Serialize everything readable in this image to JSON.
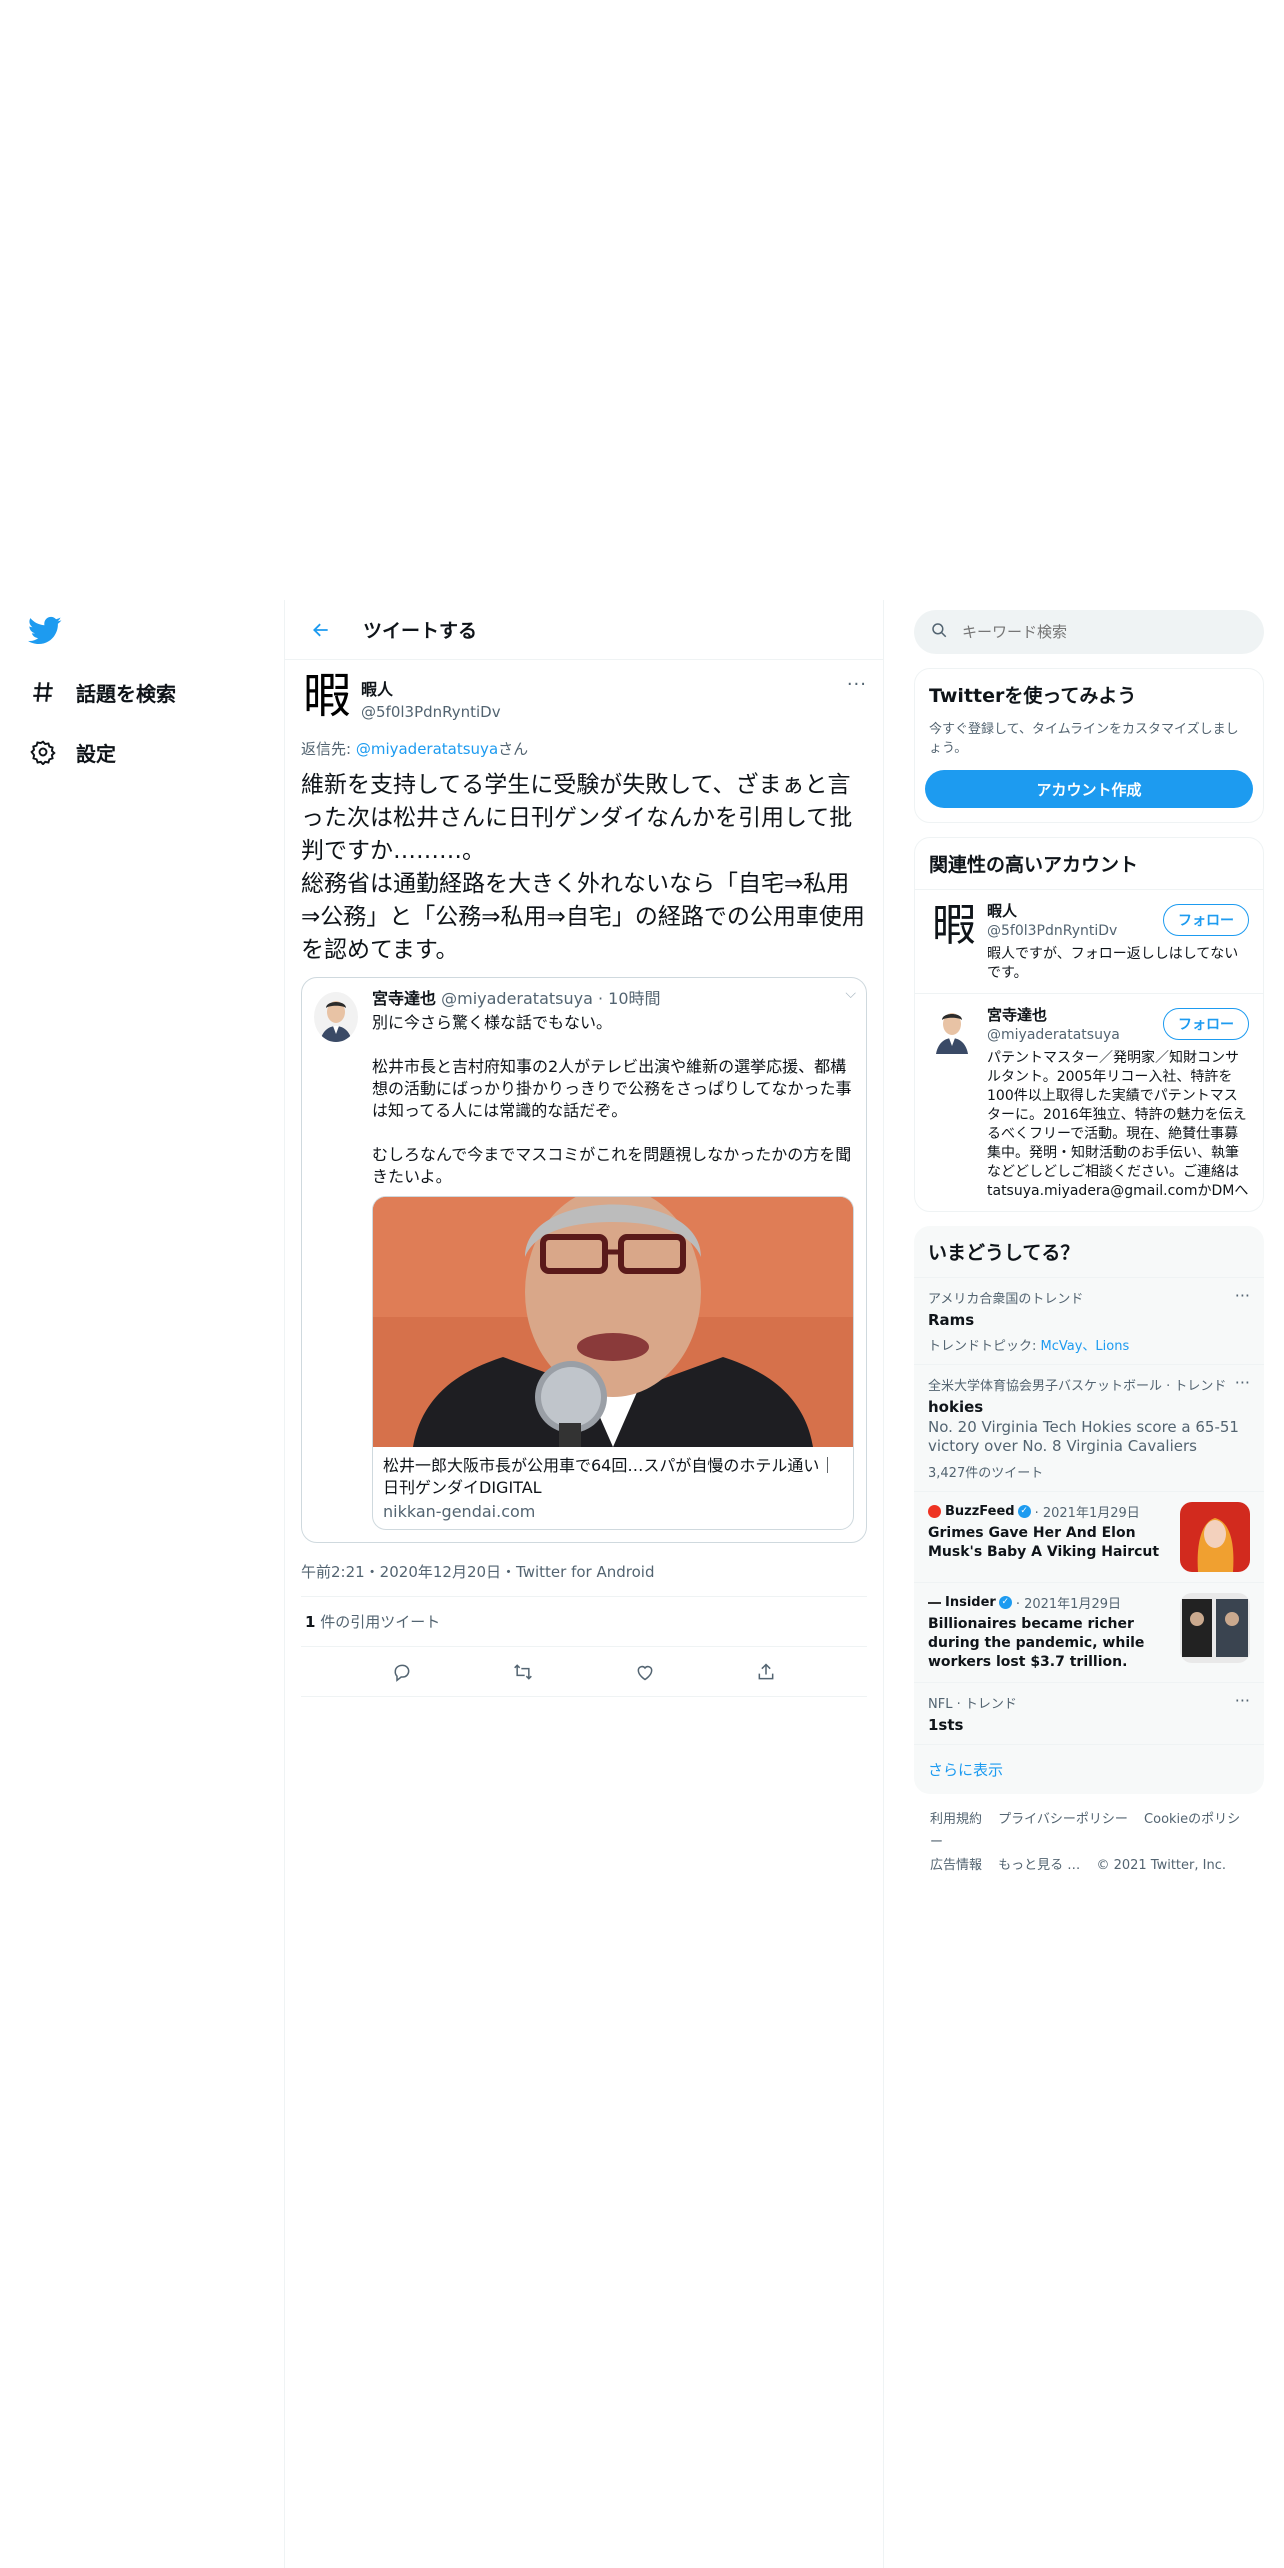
{
  "nav": {
    "logo": "twitter-bird-icon",
    "items": [
      {
        "label": "話題を検索",
        "icon": "hashtag-icon"
      },
      {
        "label": "設定",
        "icon": "gear-icon"
      }
    ]
  },
  "header": {
    "title": "ツイートする",
    "back_icon": "arrow-left-icon"
  },
  "tweet": {
    "avatar_char": "暇",
    "name": "暇人",
    "handle": "@5f0l3PdnRyntiDv",
    "more": "···",
    "reply_prefix": "返信先: ",
    "reply_handle": "@miyaderatatsuya",
    "reply_suffix": "さん",
    "text": "維新を支持してる学生に受験が失敗して、ざまぁと言った次は松井さんに日刊ゲンダイなんかを引用して批判ですか………。\n総務省は通勤経路を大きく外れないなら「自宅⇒私用⇒公務」と「公務⇒私用⇒自宅」の経路での公用車使用を認めてます。",
    "timestamp": "午前2:21・2020年12月20日・Twitter for Android",
    "quote_count_num": "1",
    "quote_count_label": " 件の引用ツイート"
  },
  "quoted": {
    "name": "宮寺達也",
    "handle": "@miyaderatatsuya",
    "time": " · 10時間",
    "text": "別に今さら驚く様な話でもない。\n\n松井市長と吉村府知事の2人がテレビ出演や維新の選挙応援、都構想の活動にばっかり掛かりっきりで公務をさっぱりしてなかった事は知ってる人には常識的な話だぞ。\n\nむしろなんで今までマスコミがこれを問題視しなかったかの方を聞きたいよ。",
    "card_title": "松井一郎大阪市長が公用車で64回…スパが自慢のホテル通い｜日刊ゲンダイDIGITAL",
    "card_domain": "nikkan-gendai.com"
  },
  "actions": [
    "reply-icon",
    "retweet-icon",
    "like-icon",
    "share-icon"
  ],
  "search": {
    "placeholder": "キーワード検索"
  },
  "signup": {
    "title": "Twitterを使ってみよう",
    "desc": "今すぐ登録して、タイムラインをカスタマイズしましょう。",
    "button": "アカウント作成"
  },
  "relevant": {
    "title": "関連性の高いアカウント",
    "accounts": [
      {
        "name": "暇人",
        "handle": "@5f0l3PdnRyntiDv",
        "bio": "暇人ですが、フォロー返ししはしてないです。",
        "follow": "フォロー",
        "avatar_char": "暇"
      },
      {
        "name": "宮寺達也",
        "handle": "@miyaderatatsuya",
        "bio": "パテントマスター／発明家／知財コンサルタント。2005年リコー入社、特許を100件以上取得した実績でパテントマスターに。2016年独立、特許の魅力を伝えるべくフリーで活動。現在、絶賛仕事募集中。発明・知財活動のお手伝い、執筆などどしどしご相談ください。ご連絡は tatsuya.miyadera@gmail.comかDMへ",
        "follow": "フォロー"
      }
    ]
  },
  "trends": {
    "title": "いまどうしてる？",
    "items": [
      {
        "context": "アメリカ合衆国のトレンド",
        "name": "Rams",
        "sub_prefix": "トレンドトピック: ",
        "sub_links": "McVay、Lions"
      },
      {
        "context": "全米大学体育協会男子バスケットボール · トレンド",
        "name": "hokies",
        "desc": "No. 20 Virginia Tech Hokies score a 65-51 victory over No. 8 Virginia Cavaliers",
        "count": "3,427件のツイート"
      }
    ],
    "news": [
      {
        "source": "BuzzFeed",
        "date": " · 2021年1月29日",
        "headline": "Grimes Gave Her And Elon Musk's Baby A Viking Haircut"
      },
      {
        "source": "Insider",
        "date": " · 2021年1月29日",
        "headline": "Billionaires became richer during the pandemic, while workers lost $3.7 trillion."
      }
    ],
    "last": {
      "context": "NFL · トレンド",
      "name": "1sts"
    },
    "show_more": "さらに表示"
  },
  "footer": {
    "links": [
      "利用規約",
      "プライバシーポリシー",
      "Cookieのポリシー",
      "広告情報",
      "もっと見る …"
    ],
    "copyright": "© 2021 Twitter, Inc."
  },
  "colors": {
    "accent": "#1d9bf0",
    "text": "#0f1419",
    "secondary": "#536471",
    "border": "#eff3f4"
  }
}
